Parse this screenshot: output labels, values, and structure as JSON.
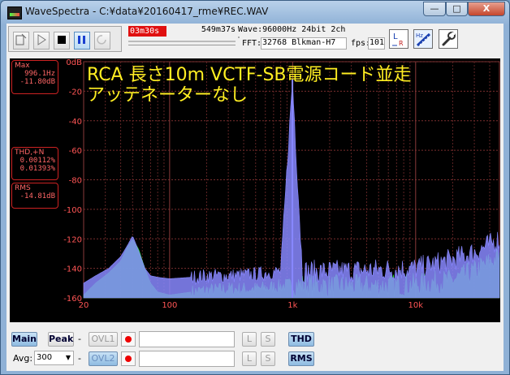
{
  "window": {
    "title": "WaveSpectra - C:¥data¥20160417_rme¥REC.WAV",
    "minimize": "—",
    "maximize": "□",
    "close": "X"
  },
  "toolbar": {
    "elapsed": "03m30s",
    "total": "549m37s",
    "wave": "Wave:96000Hz 24bit 2ch",
    "fft_label": "FFT:",
    "fft": "32768 Blkman-H7",
    "fps_label": "fps:",
    "fps": "101",
    "playback_progress_percent": 0.6
  },
  "plot": {
    "annotation_line1": "RCA 長さ10m VCTF-SB電源コード並走",
    "annotation_line2": "アッテネーターなし",
    "max": {
      "title": "Max",
      "freq": "996.1Hz",
      "level": "-11.80dB"
    },
    "thd": {
      "title": "THD,+N",
      "v1": "0.00112%",
      "v2": "0.01393%"
    },
    "rms": {
      "title": "RMS",
      "v": "-14.81dB"
    }
  },
  "chart_data": {
    "type": "line",
    "xscale": "log",
    "xlim": [
      20,
      48000
    ],
    "ylim": [
      -160,
      0
    ],
    "y_ticks": [
      "0dB",
      "-20",
      "-40",
      "-60",
      "-80",
      "-100",
      "-120",
      "-140",
      "-160"
    ],
    "x_ticks": [
      "20",
      "100",
      "1k",
      "10k"
    ],
    "grid": true,
    "series": [
      {
        "color": "#8888ff",
        "x": [
          20,
          25,
          32,
          40,
          45,
          50,
          56,
          63,
          70,
          80,
          100,
          150,
          200,
          300,
          500,
          800,
          996,
          1200,
          2000,
          5000,
          10000,
          20000,
          30000,
          40000,
          48000
        ],
        "y": [
          -150,
          -145,
          -140,
          -132,
          -125,
          -118,
          -128,
          -140,
          -145,
          -146,
          -147,
          -146,
          -145,
          -145,
          -144,
          -142,
          -12,
          -142,
          -142,
          -141,
          -140,
          -134,
          -129,
          -124,
          -120
        ]
      },
      {
        "color": "#22ff22",
        "x": [
          20,
          25,
          32,
          40,
          45,
          50,
          56,
          63,
          70,
          80,
          100,
          150,
          200,
          300,
          500,
          800,
          1000,
          2000,
          5000,
          10000,
          20000,
          30000,
          40000,
          48000
        ],
        "y": [
          -158,
          -150,
          -143,
          -135,
          -126,
          -120,
          -127,
          -140,
          -150,
          -156,
          -158,
          -156,
          -155,
          -154,
          -154,
          -152,
          -151,
          -152,
          -152,
          -151,
          -148,
          -142,
          -136,
          -132
        ]
      }
    ]
  },
  "bottom": {
    "main": "Main",
    "peak": "Peak",
    "dash": "-",
    "ovl1": "OVL1",
    "ovl2": "OVL2",
    "l": "L",
    "s": "S",
    "thd": "THD",
    "rms": "RMS",
    "avg_label": "Avg:",
    "avg_value": "300"
  }
}
